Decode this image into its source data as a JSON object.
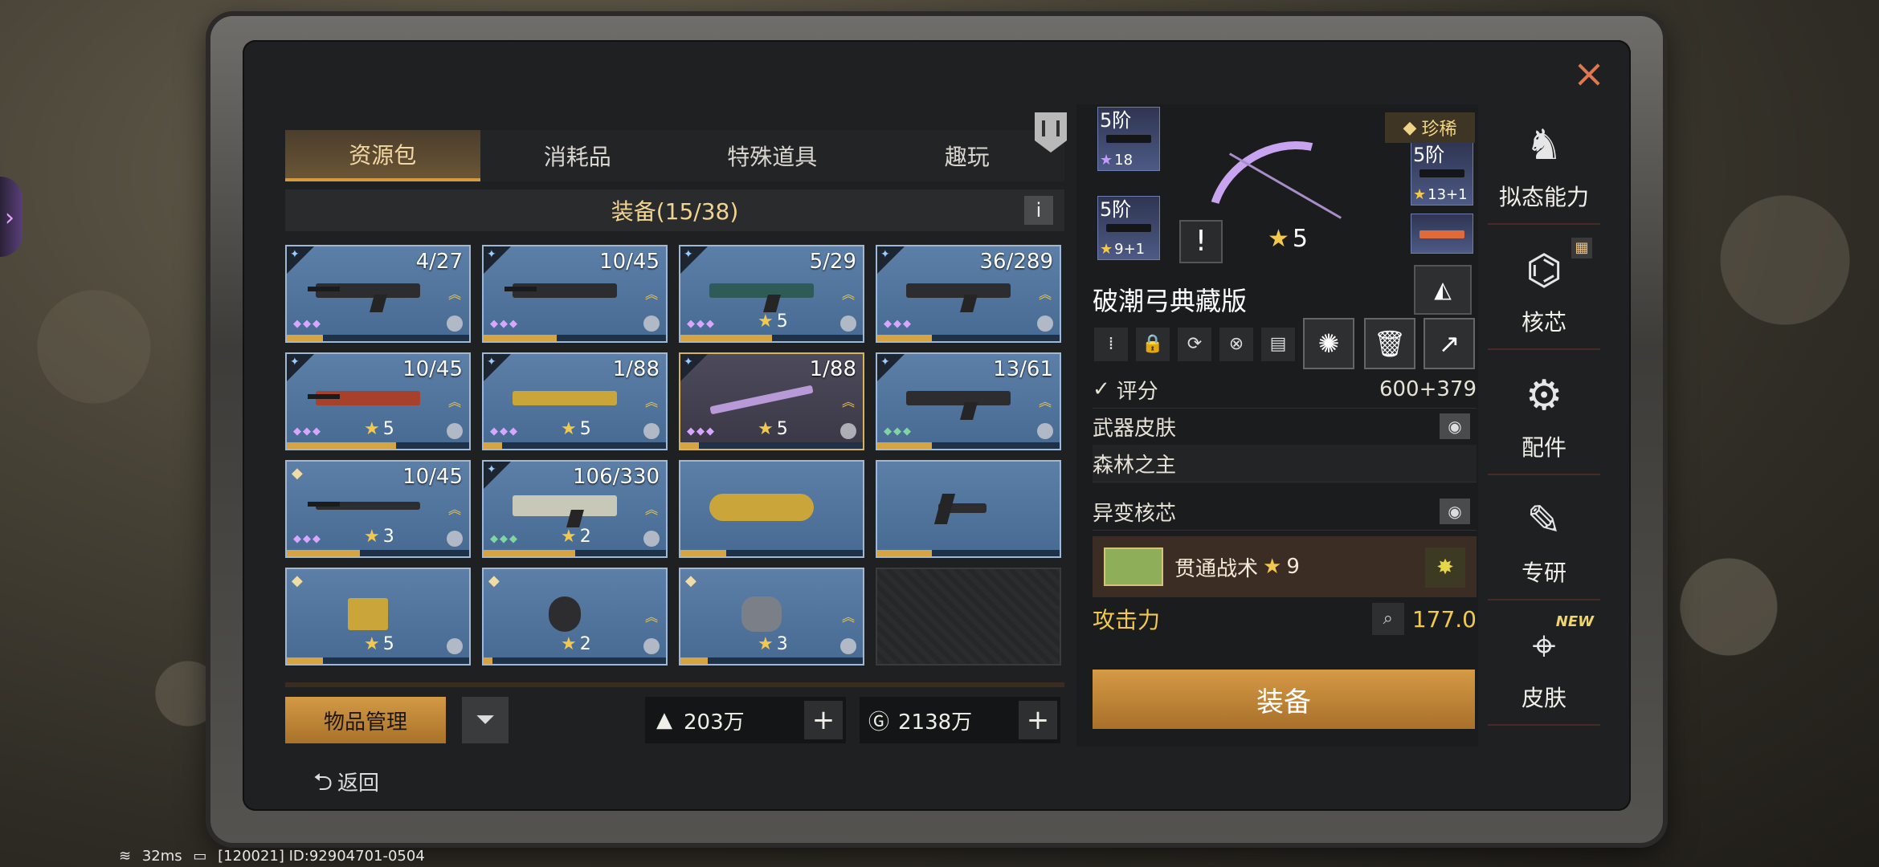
{
  "tabs": [
    "资源包",
    "消耗品",
    "特殊道具",
    "趣玩"
  ],
  "section_title": "装备(15/38)",
  "info_label": "i",
  "items": [
    {
      "count": "4/27",
      "dots": "◆◆◆",
      "star": "",
      "bar": 0.2
    },
    {
      "count": "10/45",
      "dots": "◆◆◆",
      "star": "",
      "bar": 0.4
    },
    {
      "count": "5/29",
      "dots": "◆◆◆",
      "star": "5",
      "bar": 0.5
    },
    {
      "count": "36/289",
      "dots": "◆◆◆",
      "star": "",
      "bar": 0.3
    },
    {
      "count": "10/45",
      "dots": "◆◆◆",
      "star": "5",
      "bar": 0.6
    },
    {
      "count": "1/88",
      "dots": "◆◆◆",
      "star": "5",
      "bar": 0.1
    },
    {
      "count": "1/88",
      "dots": "◆◆◆",
      "star": "5",
      "bar": 0.1
    },
    {
      "count": "13/61",
      "dots": "◆◆◆",
      "star": "",
      "bar": 0.3
    },
    {
      "count": "10/45",
      "dots": "◆◆◆",
      "star": "3",
      "bar": 0.4
    },
    {
      "count": "106/330",
      "dots": "◆◆◆",
      "star": "2",
      "bar": 0.5
    },
    {
      "count": "",
      "dots": "",
      "star": "",
      "bar": 0.25
    },
    {
      "count": "",
      "dots": "",
      "star": "",
      "bar": 0.3
    },
    {
      "count": "",
      "dots": "",
      "star": "5",
      "bar": 0.2
    },
    {
      "count": "",
      "dots": "",
      "star": "2",
      "bar": 0.05
    },
    {
      "count": "",
      "dots": "",
      "star": "3",
      "bar": 0.15
    }
  ],
  "manage_label": "物品管理",
  "currency": [
    {
      "icon": "gold-bars-icon",
      "value": "203万"
    },
    {
      "icon": "coin-icon",
      "value": "2138万"
    }
  ],
  "back_label": "返回",
  "detail": {
    "rare_label": "珍稀",
    "slots": [
      {
        "level": "5阶",
        "stars": "18"
      },
      {
        "level": "5阶",
        "stars": "9+1"
      },
      {
        "level": "5阶",
        "stars": "13+1"
      }
    ],
    "star_count": "5",
    "warn": "!",
    "weapon_name": "破潮弓典藏版",
    "score_label": "评分",
    "score_value": "600+379",
    "skin_label": "武器皮肤",
    "skin_value": "森林之主",
    "core_label": "异变核芯",
    "core_name": "贯通战术",
    "core_star": "9",
    "atk_label": "攻击力",
    "atk_value": "177.0",
    "equip_label": "装备"
  },
  "sidebar": [
    {
      "label": "拟态能力",
      "icon": "mimic-icon"
    },
    {
      "label": "核芯",
      "icon": "core-icon"
    },
    {
      "label": "配件",
      "icon": "attachment-icon"
    },
    {
      "label": "专研",
      "icon": "research-icon"
    },
    {
      "label": "皮肤",
      "icon": "skin-icon",
      "badge": "NEW"
    }
  ],
  "status": {
    "ping": "32ms",
    "id": "[120021] ID:92904701-0504"
  }
}
